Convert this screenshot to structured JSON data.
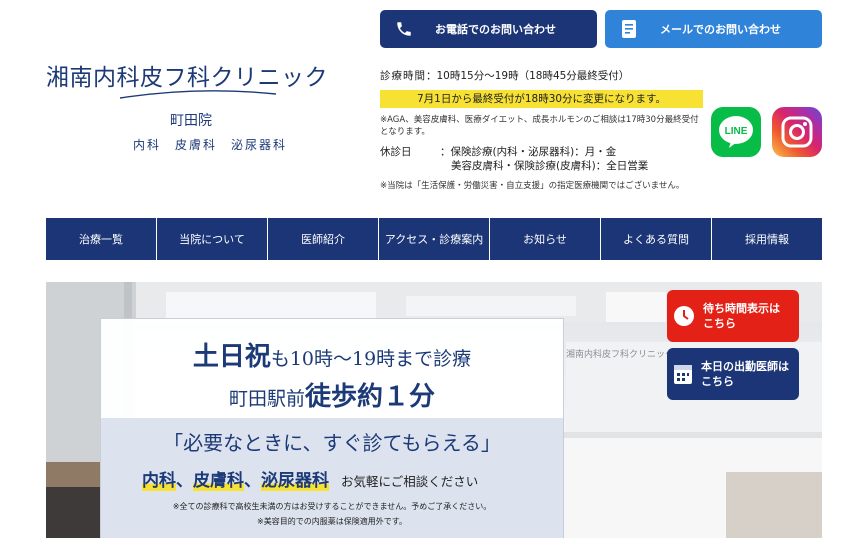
{
  "logo": {
    "title": "湘南内科皮フ科クリニック",
    "branch": "町田院",
    "departments": "内科　皮膚科　泌尿器科"
  },
  "contact": {
    "phone_label": "お電話でのお問い合わせ",
    "mail_label": "メールでのお問い合わせ"
  },
  "hours": {
    "label": "診療時間",
    "value": "：10時15分～19時（18時45分最終受付）",
    "highlight": "7月1日から最終受付が18時30分に変更になります。",
    "note": "※AGA、美容皮膚科、医療ダイエット、成長ホルモンのご相談は17時30分最終受付となります。",
    "closed_label": "休診日",
    "closed_line1": "：保険診療(内科・泌尿器科)：月・金",
    "closed_line2": "美容皮膚科・保険診療(皮膚科)：全日営業",
    "closed_note": "※当院は「生活保護・労働災害・自立支援」の指定医療機関ではございません。"
  },
  "social": {
    "line_label": "LINE"
  },
  "nav": {
    "items": [
      "治療一覧",
      "当院について",
      "医師紹介",
      "アクセス・診療案内",
      "お知らせ",
      "よくある質問",
      "採用情報"
    ]
  },
  "hero": {
    "line1_a": "土日祝",
    "line1_b": "も10時～19時まで診療",
    "line2_a": "町田駅前",
    "line2_b": "徒歩約１分",
    "catch": "「必要なときに、すぐ診てもらえる」",
    "dept1": "内科",
    "dept2": "皮膚科",
    "dept3": "泌尿器科",
    "sep": "、",
    "consult": "お気軽にご相談ください",
    "note1": "※全ての診療科で高校生未満の方はお受けすることができません。予めご了承ください。",
    "note2": "※美容目的での内服薬は保険適用外です。",
    "wall_sign": "湘南内科皮フ科クリニック"
  },
  "side": {
    "wait_label_1": "待ち時間表示は",
    "wait_label_2": "こちら",
    "doctor_label_1": "本日の出勤医師は",
    "doctor_label_2": "こちら"
  },
  "colors": {
    "navy": "#1b3577",
    "blue": "#2f83d9",
    "yellow": "#f7e133",
    "red": "#e32117",
    "line": "#08bd47"
  }
}
